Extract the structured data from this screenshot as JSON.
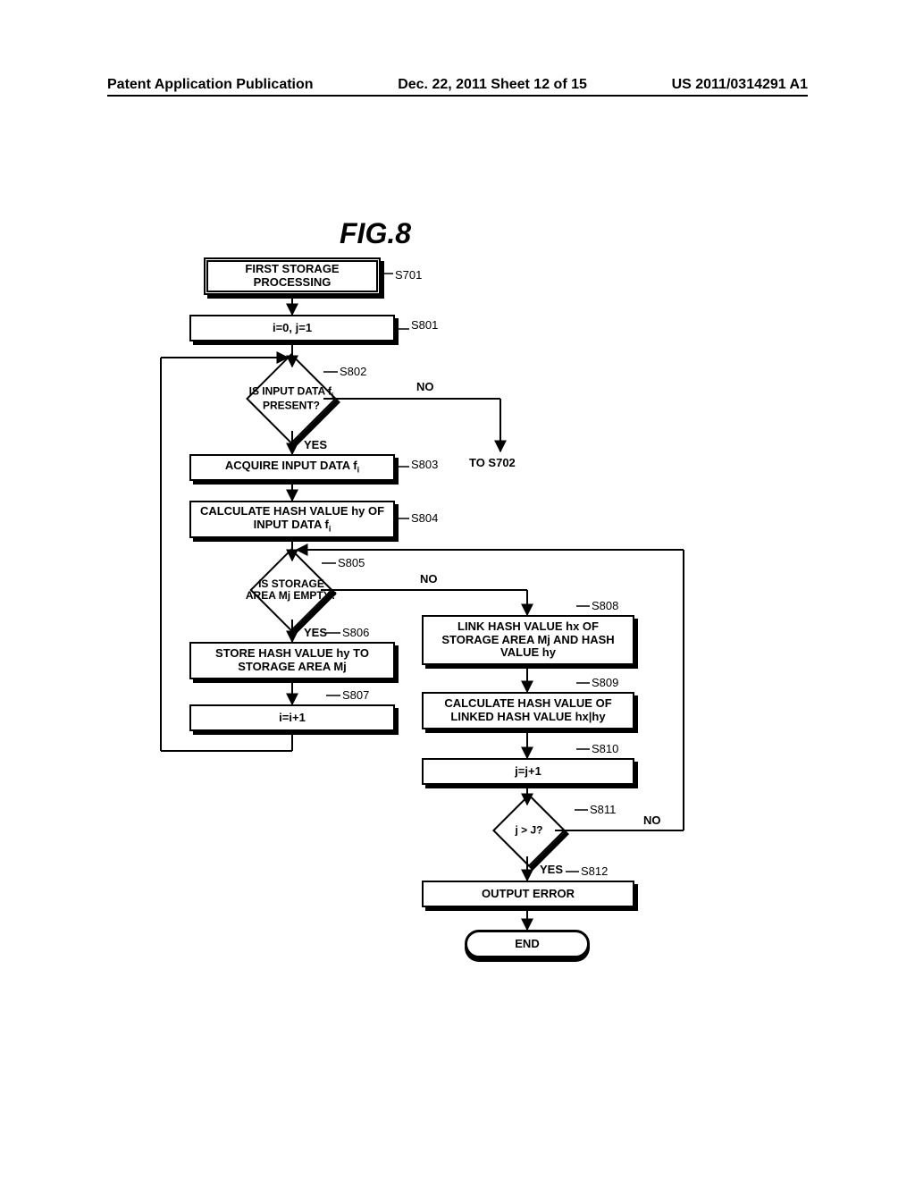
{
  "header": {
    "left": "Patent Application Publication",
    "center": "Dec. 22, 2011  Sheet 12 of 15",
    "right": "US 2011/0314291 A1"
  },
  "figure_title": "FIG.8",
  "steps": {
    "s701": {
      "label": "S701",
      "text": "FIRST STORAGE PROCESSING"
    },
    "s801": {
      "label": "S801",
      "text": "i=0, j=1"
    },
    "s802": {
      "label": "S802",
      "text": "IS INPUT DATA fᵢ PRESENT?"
    },
    "s803": {
      "label": "S803",
      "text": "ACQUIRE INPUT DATA fᵢ"
    },
    "s804": {
      "label": "S804",
      "text": "CALCULATE HASH VALUE hy OF INPUT DATA fᵢ"
    },
    "s805": {
      "label": "S805",
      "text": "IS STORAGE AREA Mj EMPTY?"
    },
    "s806": {
      "label": "S806",
      "text": "STORE HASH VALUE hy TO STORAGE AREA Mj"
    },
    "s807": {
      "label": "S807",
      "text": "i=i+1"
    },
    "s808": {
      "label": "S808",
      "text": "LINK HASH VALUE hx OF STORAGE AREA Mj AND HASH VALUE hy"
    },
    "s809": {
      "label": "S809",
      "text": "CALCULATE HASH VALUE OF LINKED HASH VALUE hx|hy"
    },
    "s810": {
      "label": "S810",
      "text": "j=j+1"
    },
    "s811": {
      "label": "S811",
      "text": "j > J?"
    },
    "s812": {
      "label": "S812",
      "text": "OUTPUT ERROR"
    }
  },
  "branches": {
    "yes": "YES",
    "no": "NO"
  },
  "links": {
    "to_s702": "TO S702"
  },
  "end_label": "END"
}
